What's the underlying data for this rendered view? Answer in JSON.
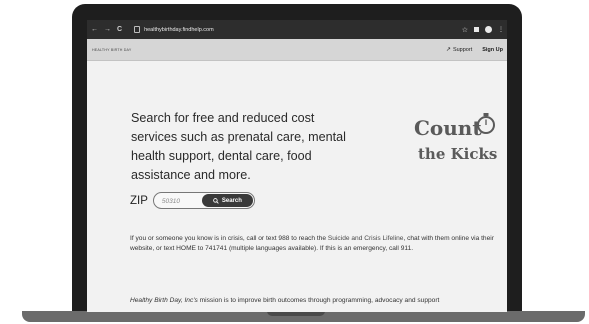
{
  "browser": {
    "url": "healthybirthday.findhelp.com",
    "nav": {
      "back": "←",
      "forward": "→",
      "reload": "C"
    }
  },
  "site": {
    "brand": "HEALTHY BIRTH DAY",
    "support_label": "Support",
    "signup_label": "Sign Up"
  },
  "main": {
    "intro": "Search for free and reduced cost services such as prenatal care, mental health support, dental care, food assistance and more.",
    "zip_label": "ZIP",
    "zip_placeholder": "50310",
    "search_label": "Search"
  },
  "logo": {
    "line1": "Count",
    "line2": "the Kicks"
  },
  "crisis": {
    "before": "If you or someone you know is in crisis, call or text 988 to reach the ",
    "link": "Suicide and Crisis Lifeline",
    "after": ", chat with them online via their website, or text HOME to 741741 (multiple languages available). If this is an emergency, call 911."
  },
  "mission": {
    "org": "Healthy Birth Day, Inc's",
    "text": " mission is to improve birth outcomes through programming, advocacy and support"
  },
  "colors": {
    "bezel": "#1e1e1e",
    "page_bg": "#f2f2f2",
    "header_bg": "#d6d6d6",
    "button_bg": "#3a3a3a"
  }
}
